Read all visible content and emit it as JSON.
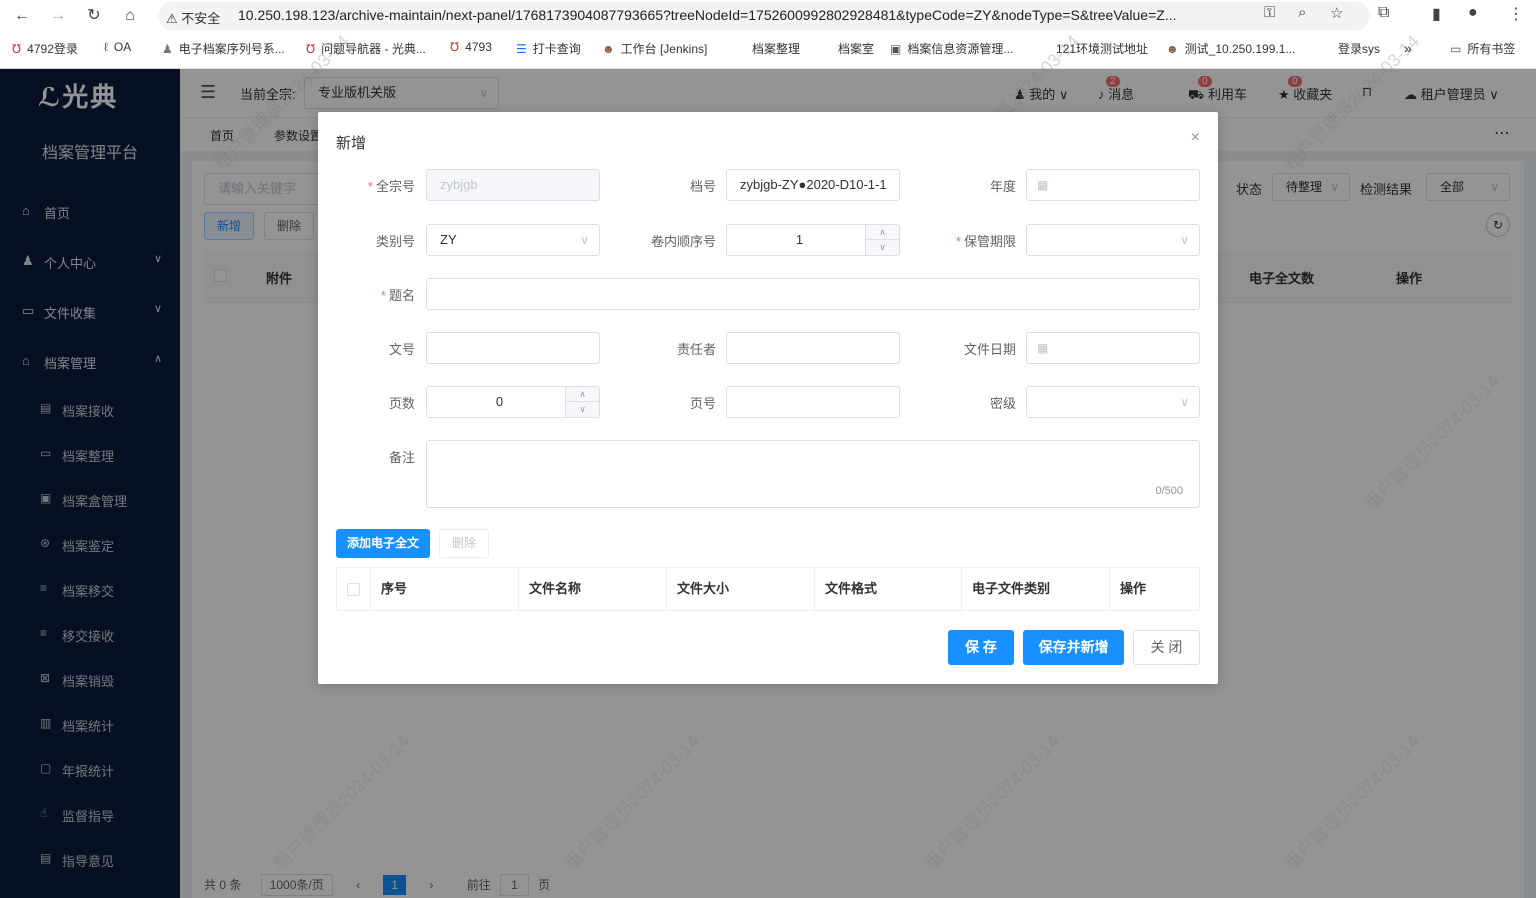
{
  "browser": {
    "insecure_label": "不安全",
    "url": "10.250.198.123/archive-maintain/next-panel/1768173904087793665?treeNodeId=1752600992802928481&typeCode=ZY&nodeType=S&treeValue=Z...",
    "bookmarks": [
      "4792登录",
      "OA",
      "电子档案序列号系...",
      "问题导航器 - 光典...",
      "4793",
      "打卡查询",
      "工作台 [Jenkins]",
      "档案整理",
      "档案室",
      "档案信息资源管理...",
      "121环境测试地址",
      "测试_10.250.199.1...",
      "登录sys"
    ],
    "all_bookmarks": "所有书签"
  },
  "sidebar": {
    "logo": "光典",
    "platform": "档案管理平台",
    "menu": [
      {
        "label": "首页",
        "icon": "home-icon"
      },
      {
        "label": "个人中心",
        "icon": "user-icon"
      },
      {
        "label": "文件收集",
        "icon": "folder-icon"
      },
      {
        "label": "档案管理",
        "icon": "bank-icon"
      }
    ],
    "submenu": [
      "档案接收",
      "档案整理",
      "档案盒管理",
      "档案鉴定",
      "档案移交",
      "移交接收",
      "档案销毁",
      "档案统计",
      "年报统计",
      "监督指导",
      "指导意见"
    ]
  },
  "topbar": {
    "fonds_label": "当前全宗:",
    "fonds_value": "专业版机关版",
    "my": "我的",
    "msg": "消息",
    "msg_badge": "2",
    "cart": "利用车",
    "cart_badge": "0",
    "fav": "收藏夹",
    "fav_badge": "0",
    "admin": "租户管理员"
  },
  "tabs": [
    "首页",
    "参数设置"
  ],
  "background_panel": {
    "search_placeholder": "请输入关键字",
    "add": "新增",
    "delete": "删除",
    "status_label": "状态",
    "status_value": "待整理",
    "check_label": "检测结果",
    "check_value": "全部",
    "col_attachment": "附件",
    "col_fulltext": "电子全文数",
    "col_op": "操作",
    "total": "共 0 条",
    "page_size": "1000条/页",
    "page": "1",
    "goto": "前往",
    "goto_page": "1",
    "page_suffix": "页"
  },
  "watermark": "租户管理员2024-03-14",
  "dialog": {
    "title": "新增",
    "fields": {
      "fonds_no": {
        "label": "全宗号",
        "value": "zybjgb"
      },
      "archive_no": {
        "label": "档号",
        "value": "zybjgb-ZY●2020-D10-1-1"
      },
      "year": {
        "label": "年度",
        "value": ""
      },
      "category": {
        "label": "类别号",
        "value": "ZY"
      },
      "seq": {
        "label": "卷内顺序号",
        "value": "1"
      },
      "retention": {
        "label": "保管期限",
        "value": ""
      },
      "title": {
        "label": "题名",
        "value": ""
      },
      "doc_no": {
        "label": "文号",
        "value": ""
      },
      "responsible": {
        "label": "责任者",
        "value": ""
      },
      "doc_date": {
        "label": "文件日期",
        "value": ""
      },
      "pages": {
        "label": "页数",
        "value": "0"
      },
      "page_no": {
        "label": "页号",
        "value": ""
      },
      "secret": {
        "label": "密级",
        "value": ""
      },
      "remark": {
        "label": "备注",
        "value": "",
        "counter": "0/500"
      }
    },
    "add_fulltext": "添加电子全文",
    "delete": "删除",
    "table_headers": [
      "序号",
      "文件名称",
      "文件大小",
      "文件格式",
      "电子文件类别",
      "操作"
    ],
    "save": "保 存",
    "save_new": "保存并新增",
    "close": "关 闭"
  }
}
